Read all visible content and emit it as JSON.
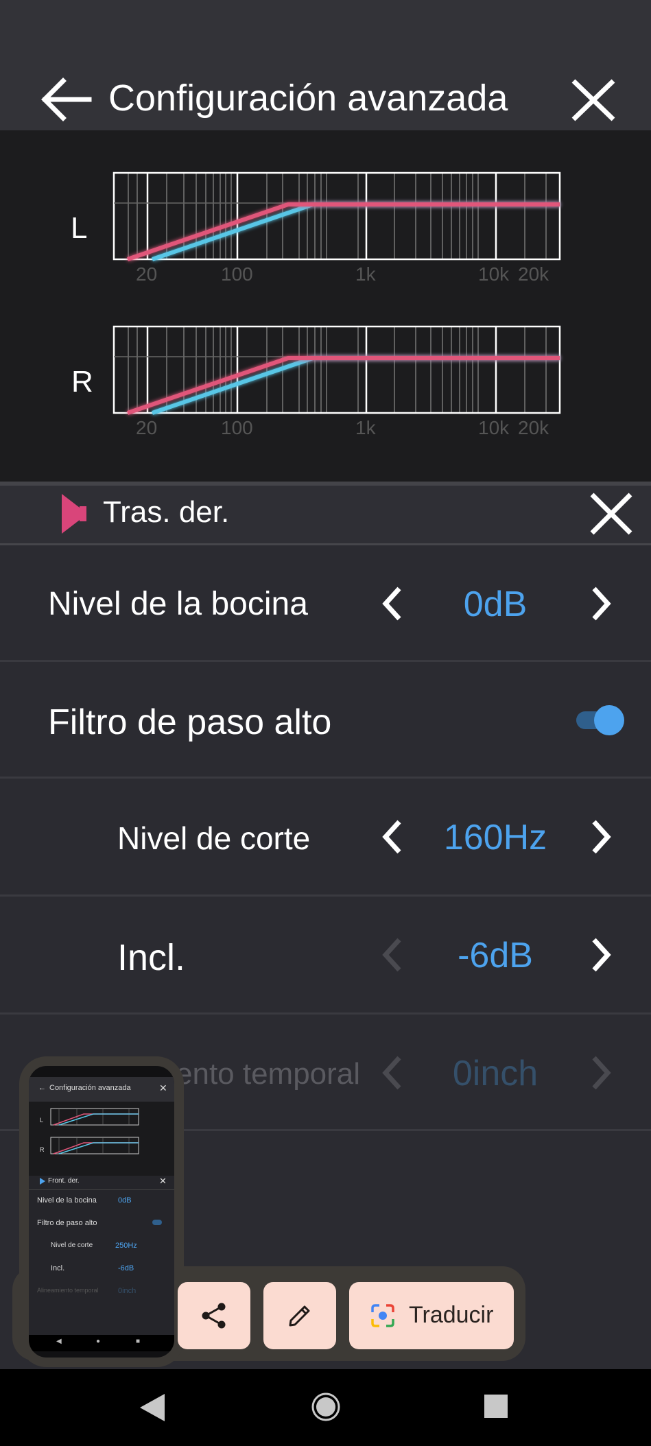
{
  "header": {
    "title": "Configuración avanzada",
    "back_icon": "arrow-left-icon",
    "close_icon": "close-icon"
  },
  "graphs": {
    "channels": [
      "L",
      "R"
    ],
    "freq_labels": [
      "20",
      "100",
      "1k",
      "10k",
      "20k"
    ],
    "colors": {
      "yellow": "#e2c56a",
      "pink": "#e0567a",
      "cyan": "#58c6e6"
    }
  },
  "speaker": {
    "title": "Tras. der.",
    "icon": "speaker-icon",
    "accent": "#d9457a"
  },
  "settings": {
    "speaker_level": {
      "label": "Nivel de la bocina",
      "value": "0dB"
    },
    "high_pass": {
      "label": "Filtro de paso alto",
      "enabled": true
    },
    "cutoff": {
      "label": "Nivel de corte",
      "value": "160Hz"
    },
    "slope": {
      "label": "Incl.",
      "value": "-6dB"
    },
    "time_alignment": {
      "label": "ento temporal",
      "value": "0inch"
    }
  },
  "thumbnail": {
    "title": "Configuración avanzada",
    "speaker": "Front. der.",
    "rows": [
      {
        "label": "Nivel de la bocina",
        "value": "0dB"
      },
      {
        "label": "Filtro de paso alto",
        "value": ""
      },
      {
        "label": "Nivel de corte",
        "value": "250Hz"
      },
      {
        "label": "Incl.",
        "value": "-6dB"
      },
      {
        "label": "Alineamiento temporal",
        "value": "0inch"
      }
    ],
    "channels": [
      "L",
      "R"
    ]
  },
  "toolbar": {
    "share_icon": "share-icon",
    "edit_icon": "pencil-icon",
    "translate_label": "Traducir",
    "translate_icon": "google-lens-icon"
  },
  "navbar": {
    "back_icon": "nav-back-icon",
    "home_icon": "nav-home-icon",
    "recents_icon": "nav-recents-icon"
  }
}
